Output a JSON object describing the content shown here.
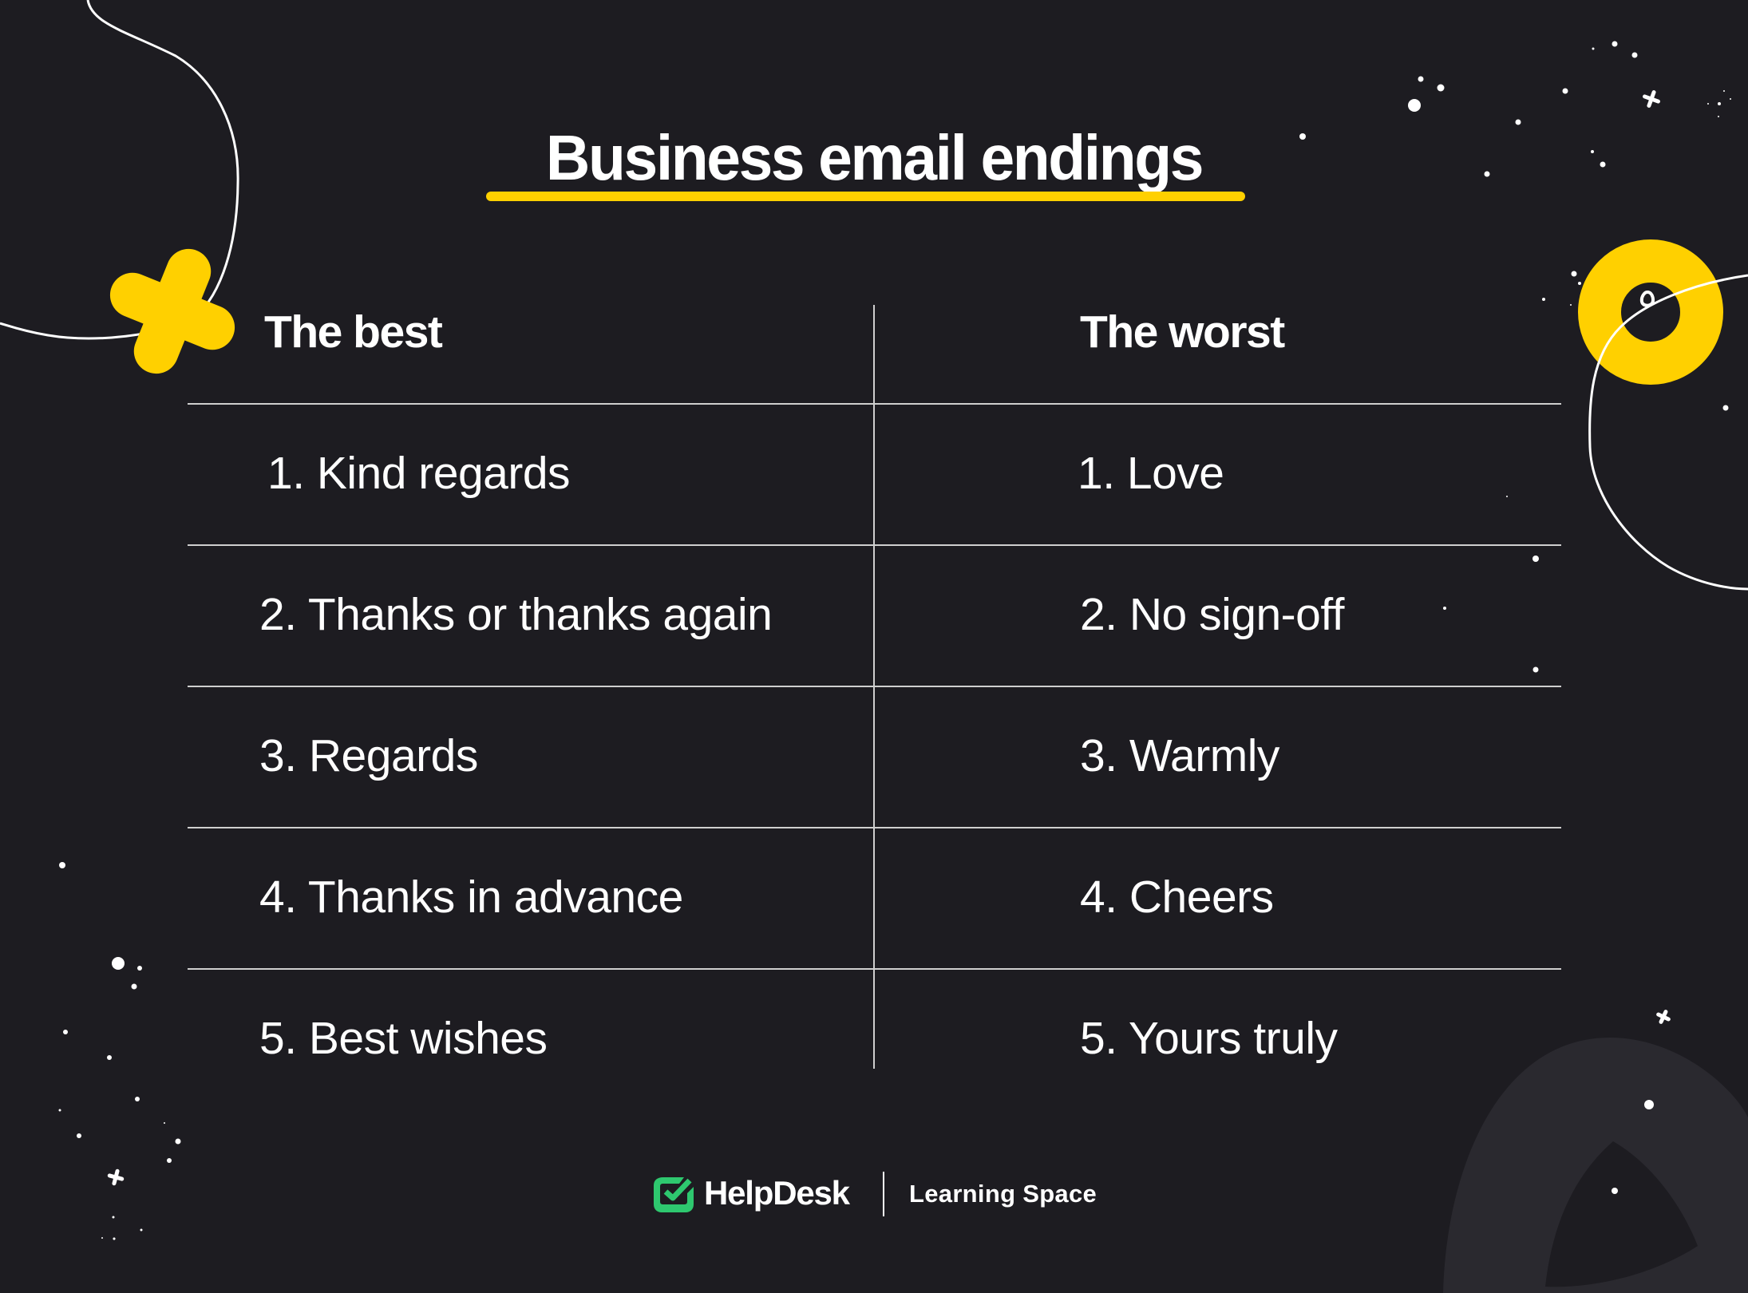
{
  "title": "Business email endings",
  "colors": {
    "background": "#1d1c21",
    "accent_yellow": "#ffd000",
    "brand_green": "#2ec86f",
    "divider": "#cfcfcf",
    "arch": "#2a292f"
  },
  "table": {
    "columns": [
      {
        "header": "The best",
        "items": [
          "1. Kind regards",
          "2. Thanks or thanks again",
          "3. Regards",
          "4. Thanks in advance",
          "5. Best wishes"
        ]
      },
      {
        "header": "The worst",
        "items": [
          "1. Love",
          "2. No sign-off",
          "3. Warmly",
          "4. Cheers",
          "5. Yours truly"
        ]
      }
    ]
  },
  "footer": {
    "logo_icon": "checkbox-check-icon",
    "brand": "HelpDesk",
    "subtitle": "Learning Space"
  }
}
